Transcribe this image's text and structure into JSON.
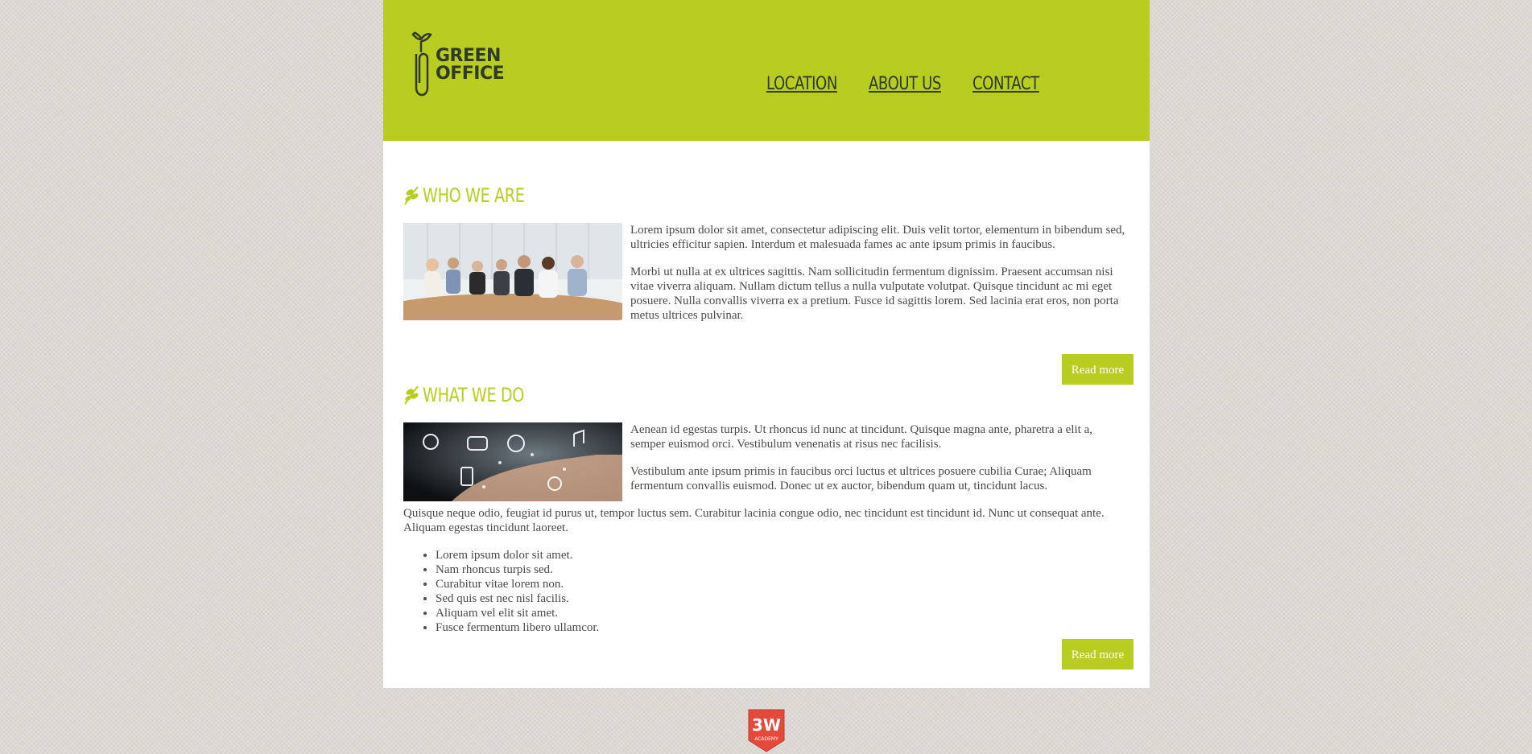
{
  "header": {
    "logo_line1": "GREEN",
    "logo_line2": "OFFICE",
    "nav": [
      "LOCATION",
      "ABOUT US",
      "CONTACT"
    ]
  },
  "sections": [
    {
      "title": "WHO WE ARE",
      "paragraphs": [
        "Lorem ipsum dolor sit amet, consectetur adipiscing elit. Duis velit tortor, elementum in bibendum sed, ultricies efficitur sapien. Interdum et malesuada fames ac ante ipsum primis in faucibus.",
        "Morbi ut nulla at ex ultrices sagittis. Nam sollicitudin fermentum dignissim. Praesent accumsan nisi vitae viverra aliquam. Nullam dictum tellus a nulla vulputate volutpat. Quisque tincidunt ac mi eget posuere. Nulla convallis viverra ex a pretium. Fusce id sagittis lorem. Sed lacinia erat eros, non porta metus ultrices pulvinar."
      ],
      "button": "Read more"
    },
    {
      "title": "WHAT WE DO",
      "paragraphs": [
        "Aenean id egestas turpis. Ut rhoncus id nunc at tincidunt. Quisque magna ante, pharetra a elit a, semper euismod orci. Vestibulum venenatis at risus nec facilisis.",
        "Vestibulum ante ipsum primis in faucibus orci luctus et ultrices posuere cubilia Curae; Aliquam fermentum convallis euismod. Donec ut ex auctor, bibendum quam ut, tincidunt lacus.",
        "Quisque neque odio, feugiat id purus ut, tempor luctus sem. Curabitur lacinia congue odio, nec tincidunt est tincidunt id. Nunc ut consequat ante. Aliquam egestas tincidunt laoreet."
      ],
      "list": [
        "Lorem ipsum dolor sit amet.",
        "Nam rhoncus turpis sed.",
        "Curabitur vitae lorem non.",
        "Sed quis est nec nisl facilis.",
        "Aliquam vel elit sit amet.",
        "Fusce fermentum libero ullamcor."
      ],
      "button": "Read more"
    }
  ],
  "footer": {
    "badge_text": "3W",
    "badge_subtext": "ACADEMY"
  },
  "colors": {
    "accent": "#b9cc20",
    "background": "#ddd9d3",
    "text": "#4a4a4a",
    "nav_text": "#2e3a28",
    "badge": "#e5493a"
  }
}
